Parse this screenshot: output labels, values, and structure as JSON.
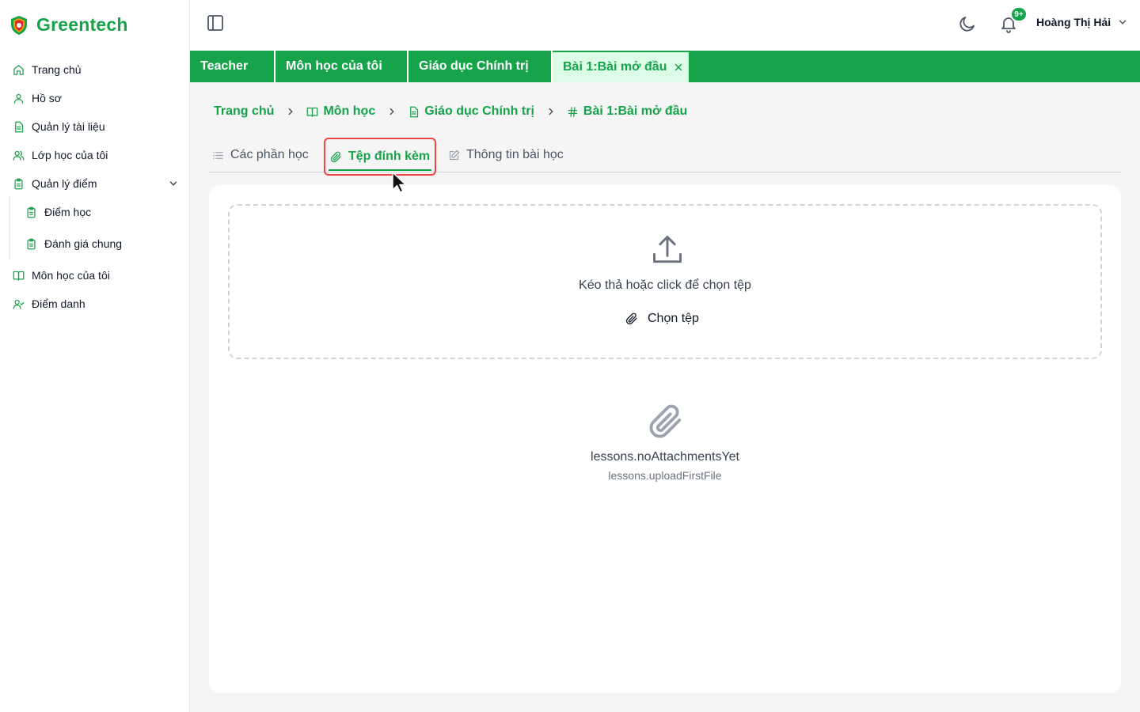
{
  "brand": {
    "name": "Greentech",
    "color": "#16a34a"
  },
  "sidebar": {
    "items": [
      {
        "label": "Trang chủ",
        "icon": "home-icon"
      },
      {
        "label": "Hồ sơ",
        "icon": "user-icon"
      },
      {
        "label": "Quản lý tài liệu",
        "icon": "document-icon"
      },
      {
        "label": "Lớp học của tôi",
        "icon": "users-icon"
      },
      {
        "label": "Quản lý điểm",
        "icon": "clipboard-icon",
        "expanded": true
      },
      {
        "label": "Điểm học",
        "icon": "clipboard-icon"
      },
      {
        "label": "Đánh giá chung",
        "icon": "clipboard-icon"
      },
      {
        "label": "Môn học của tôi",
        "icon": "book-icon"
      },
      {
        "label": "Điểm danh",
        "icon": "user-check-icon"
      }
    ]
  },
  "header": {
    "notification_badge": "9+",
    "user_name": "Hoàng Thị Hải"
  },
  "tabs": [
    {
      "label": "Teacher"
    },
    {
      "label": "Môn học của tôi"
    },
    {
      "label": "Giáo dục Chính trị"
    },
    {
      "label": "Bài 1:Bài mở đầu",
      "active": true
    }
  ],
  "breadcrumb": [
    {
      "label": "Trang chủ"
    },
    {
      "label": "Môn học",
      "icon": "book-icon"
    },
    {
      "label": "Giáo dục Chính trị",
      "icon": "document-icon"
    },
    {
      "label": "Bài 1:Bài mở đầu",
      "icon": "hash-icon"
    }
  ],
  "content_tabs": [
    {
      "label": "Các phần học",
      "icon": "list-icon"
    },
    {
      "label": "Tệp đính kèm",
      "icon": "paperclip-icon",
      "active": true
    },
    {
      "label": "Thông tin bài học",
      "icon": "edit-icon"
    }
  ],
  "upload": {
    "hint": "Kéo thả hoặc click để chọn tệp",
    "button_label": "Chọn tệp"
  },
  "empty_state": {
    "title": "lessons.noAttachmentsYet",
    "subtitle": "lessons.uploadFirstFile"
  }
}
